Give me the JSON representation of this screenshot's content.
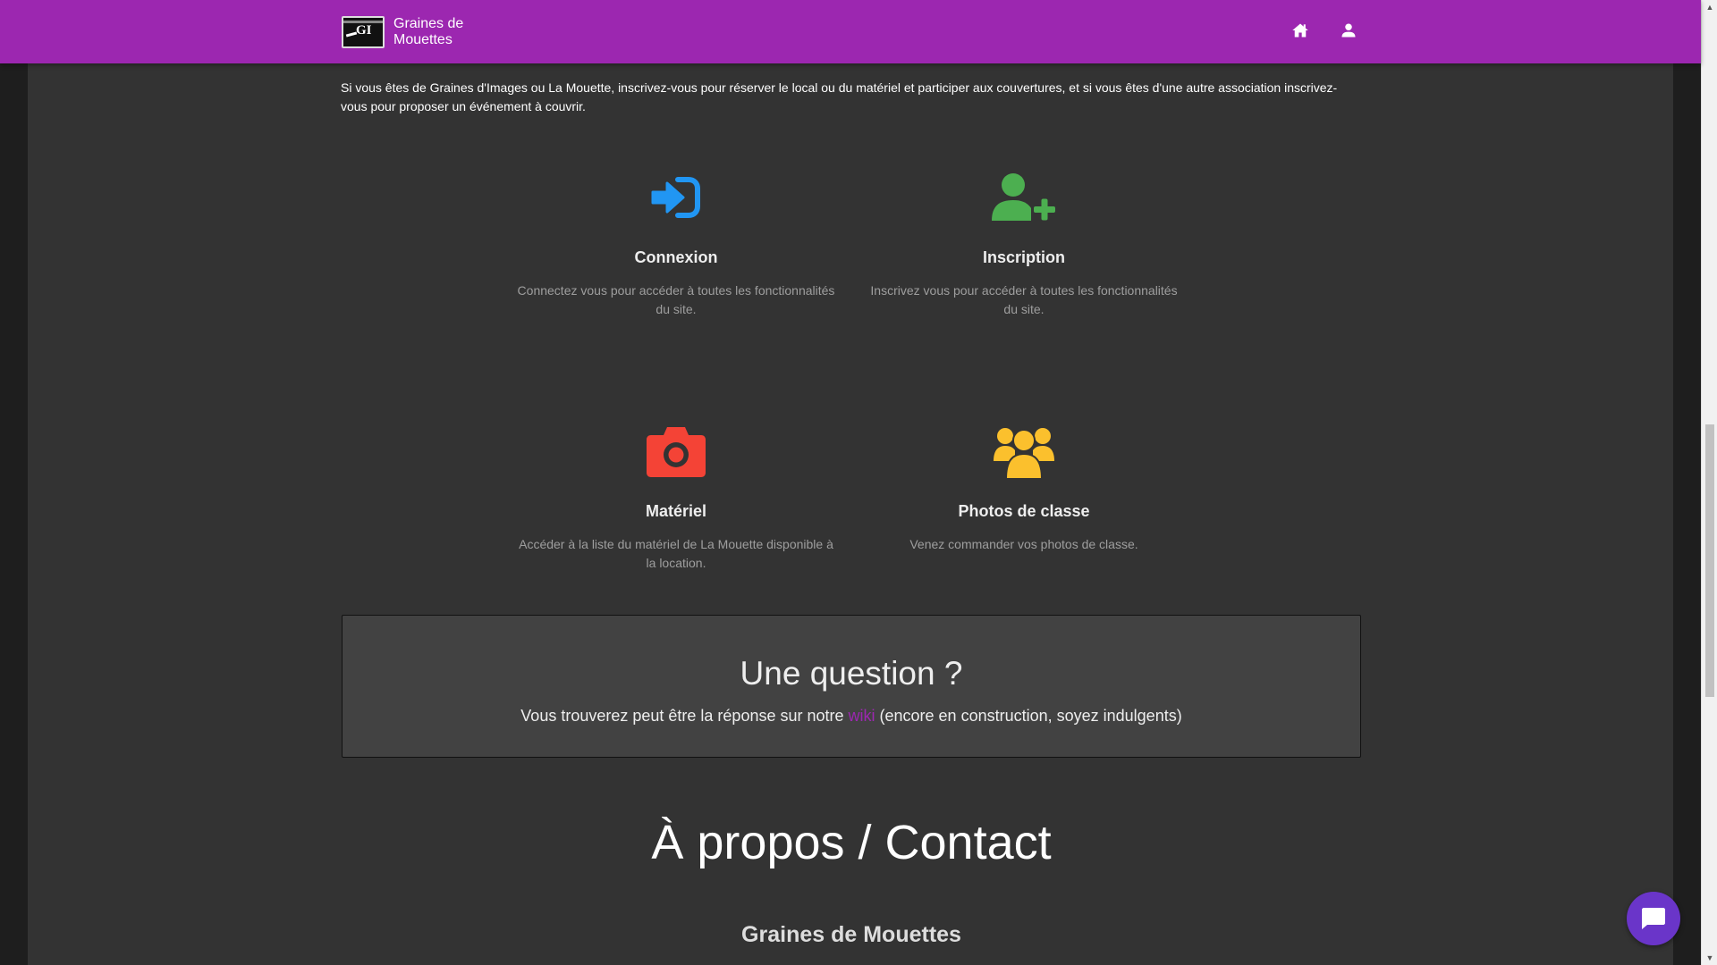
{
  "brand": {
    "name": "Graines de Mouettes",
    "logo_text": "GI"
  },
  "navbar": {
    "home_icon": "home-icon",
    "user_icon": "user-icon"
  },
  "intro": "Si vous êtes de Graines d'Images ou La Mouette, inscrivez-vous pour réserver le local ou du matériel et participer aux couvertures, et si vous êtes d'une autre association inscrivez-vous pour proposer un événement à couvrir.",
  "features": [
    {
      "title": "Connexion",
      "desc": "Connectez vous pour accéder à toutes les fonctionnalités du site.",
      "icon": "sign-in-icon",
      "color": "#2196f3"
    },
    {
      "title": "Inscription",
      "desc": "Inscrivez vous pour accéder à toutes les fonctionnalités du site.",
      "icon": "user-plus-icon",
      "color": "#4caf50"
    },
    {
      "title": "Matériel",
      "desc": "Accéder à la liste du matériel de La Mouette disponible à la location.",
      "icon": "camera-icon",
      "color": "#f44336"
    },
    {
      "title": "Photos de classe",
      "desc": "Venez commander vos photos de classe.",
      "icon": "users-icon",
      "color": "#fbc02d"
    }
  ],
  "question": {
    "title": "Une question ?",
    "text_before": "Vous trouverez peut être la réponse sur notre ",
    "link": "wiki",
    "text_after": " (encore en construction, soyez indulgents)"
  },
  "about": {
    "title": "À propos / Contact",
    "subtitle": "Graines de Mouettes"
  },
  "chat": {
    "icon": "chat-icon",
    "color": "#6a35c9"
  },
  "colors": {
    "navbar": "#9c27b0",
    "background": "#333333",
    "box": "#424242"
  }
}
